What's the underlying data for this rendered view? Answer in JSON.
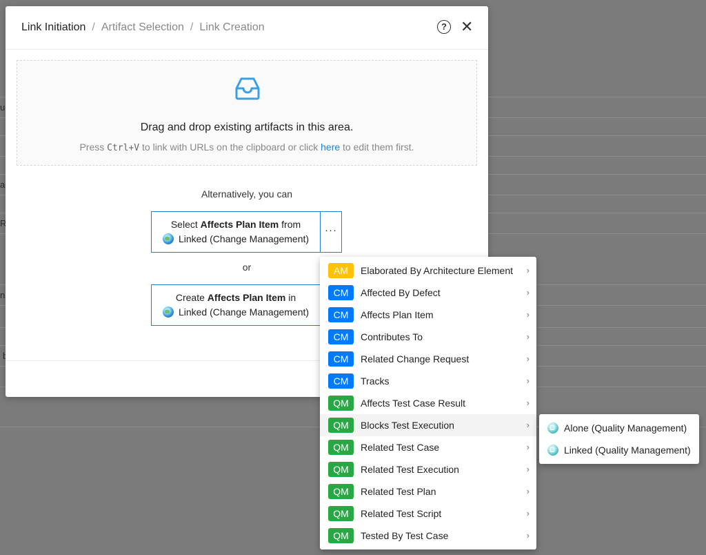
{
  "header": {
    "crumbs": [
      "Link Initiation",
      "Artifact Selection",
      "Link Creation"
    ],
    "separator": "/",
    "help_symbol": "?",
    "close_symbol": "✕"
  },
  "icons": {
    "help": "question-circle-icon",
    "close": "close-icon",
    "inbox": "inbox-icon",
    "globe": "globe-icon",
    "chevron": "chevron-right-icon",
    "qm_provider": "quality-management-provider-icon"
  },
  "dropzone": {
    "title": "Drag and drop existing artifacts in this area.",
    "hint_prefix": "Press ",
    "hint_key": "Ctrl+V",
    "hint_middle": " to link with URLs on the clipboard or click ",
    "hint_link": "here",
    "hint_suffix": " to edit them first."
  },
  "alternatively": "Alternatively, you can",
  "or": "or",
  "select_button": {
    "prefix": "Select ",
    "type": "Affects Plan Item",
    "suffix": " from",
    "source": "Linked (Change Management)"
  },
  "create_button": {
    "prefix": "Create ",
    "type": "Affects Plan Item",
    "suffix": " in",
    "source": "Linked (Change Management)"
  },
  "more_button": "···",
  "colors": {
    "AM": "#ffc107",
    "CM": "#007bff",
    "QM": "#28a745",
    "accent": "#1a7fd6"
  },
  "menu": {
    "chevron": "›",
    "items": [
      {
        "tag": "AM",
        "label": "Elaborated By Architecture Element"
      },
      {
        "tag": "CM",
        "label": "Affected By Defect"
      },
      {
        "tag": "CM",
        "label": "Affects Plan Item"
      },
      {
        "tag": "CM",
        "label": "Contributes To"
      },
      {
        "tag": "CM",
        "label": "Related Change Request"
      },
      {
        "tag": "CM",
        "label": "Tracks"
      },
      {
        "tag": "QM",
        "label": "Affects Test Case Result"
      },
      {
        "tag": "QM",
        "label": "Blocks Test Execution",
        "active": true
      },
      {
        "tag": "QM",
        "label": "Related Test Case"
      },
      {
        "tag": "QM",
        "label": "Related Test Execution"
      },
      {
        "tag": "QM",
        "label": "Related Test Plan"
      },
      {
        "tag": "QM",
        "label": "Related Test Script"
      },
      {
        "tag": "QM",
        "label": "Tested By Test Case"
      }
    ]
  },
  "submenu": {
    "items": [
      {
        "label": "Alone (Quality Management)"
      },
      {
        "label": "Linked (Quality Management)"
      }
    ]
  },
  "background_fragments": [
    "ur",
    "ac",
    "Re",
    "n:",
    "b"
  ]
}
